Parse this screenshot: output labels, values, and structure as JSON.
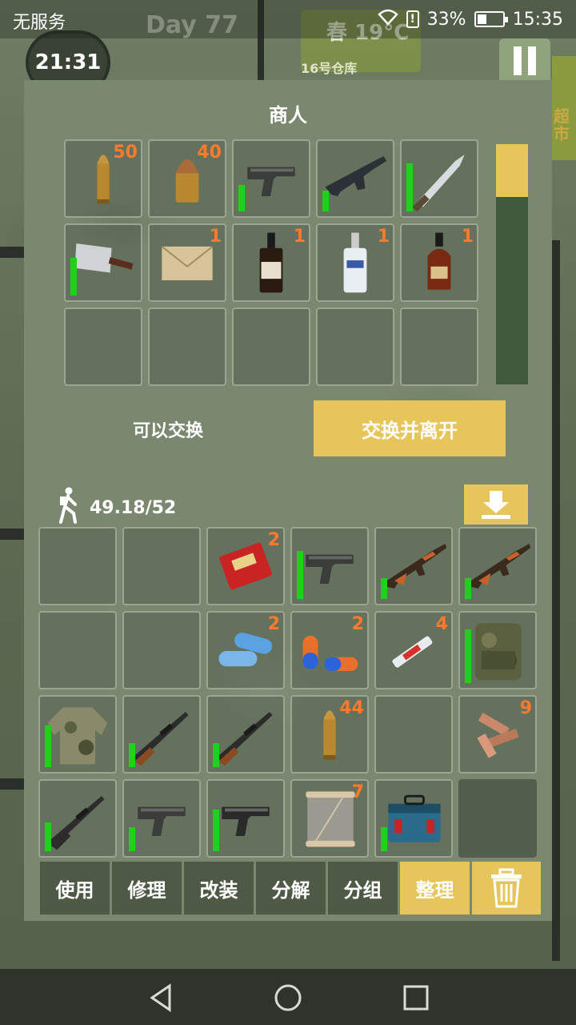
{
  "status_bar": {
    "carrier": "无服务",
    "battery_percent": "33%",
    "time": "15:35"
  },
  "hud": {
    "clock": "21:31",
    "day": "Day 77",
    "season": "春",
    "temperature": "19°C",
    "location": "16号仓库",
    "side_label": "超市"
  },
  "merchant": {
    "title": "商人",
    "items": [
      {
        "name": "rifle-ammo",
        "qty": "50",
        "durability": null
      },
      {
        "name": "pistol-ammo",
        "qty": "40",
        "durability": null
      },
      {
        "name": "pistol",
        "qty": null,
        "durability": 0.38
      },
      {
        "name": "assault-rifle",
        "qty": null,
        "durability": 0.3
      },
      {
        "name": "combat-knife",
        "qty": null,
        "durability": 0.7
      },
      {
        "name": "cleaver",
        "qty": null,
        "durability": 0.55
      },
      {
        "name": "envelope",
        "qty": "1",
        "durability": null
      },
      {
        "name": "whiskey",
        "qty": "1",
        "durability": null
      },
      {
        "name": "vodka",
        "qty": "1",
        "durability": null
      },
      {
        "name": "cognac",
        "qty": "1",
        "durability": null
      },
      {
        "name": "empty",
        "qty": null,
        "durability": null
      },
      {
        "name": "empty",
        "qty": null,
        "durability": null
      },
      {
        "name": "empty",
        "qty": null,
        "durability": null
      },
      {
        "name": "empty",
        "qty": null,
        "durability": null
      },
      {
        "name": "empty",
        "qty": null,
        "durability": null
      }
    ],
    "scroll_position": 0.0
  },
  "trade": {
    "status": "可以交换",
    "button": "交换并离开"
  },
  "inventory": {
    "weight": "49.18/52",
    "items": [
      {
        "name": "empty",
        "qty": null,
        "durability": null
      },
      {
        "name": "empty",
        "qty": null,
        "durability": null
      },
      {
        "name": "cigarettes",
        "qty": "2",
        "durability": null
      },
      {
        "name": "pistol",
        "qty": null,
        "durability": 0.7
      },
      {
        "name": "ak-rifle",
        "qty": null,
        "durability": 0.3
      },
      {
        "name": "ak-rifle",
        "qty": null,
        "durability": 0.3
      },
      {
        "name": "empty",
        "qty": null,
        "durability": null
      },
      {
        "name": "empty",
        "qty": null,
        "durability": null
      },
      {
        "name": "pills-blue",
        "qty": "2",
        "durability": null
      },
      {
        "name": "pills-orange",
        "qty": "2",
        "durability": null
      },
      {
        "name": "syringe",
        "qty": "4",
        "durability": null
      },
      {
        "name": "camo-backpack",
        "qty": null,
        "durability": 0.78
      },
      {
        "name": "camo-jacket",
        "qty": null,
        "durability": 0.6
      },
      {
        "name": "hunting-rifle",
        "qty": null,
        "durability": 0.35
      },
      {
        "name": "hunting-rifle",
        "qty": null,
        "durability": 0.35
      },
      {
        "name": "rifle-ammo",
        "qty": "44",
        "durability": null
      },
      {
        "name": "empty",
        "qty": null,
        "durability": null
      },
      {
        "name": "scrap-wood",
        "qty": "9",
        "durability": null
      },
      {
        "name": "sniper-rifle",
        "qty": null,
        "durability": 0.42
      },
      {
        "name": "pistol",
        "qty": null,
        "durability": 0.35
      },
      {
        "name": "pistol-black",
        "qty": null,
        "durability": 0.6
      },
      {
        "name": "thread-spool",
        "qty": "7",
        "durability": null
      },
      {
        "name": "toolbox",
        "qty": null,
        "durability": 0.35
      },
      {
        "name": "locked",
        "qty": null,
        "durability": null
      }
    ]
  },
  "actions": {
    "use": "使用",
    "repair": "修理",
    "modify": "改装",
    "disassemble": "分解",
    "group": "分组",
    "sort": "整理"
  },
  "colors": {
    "accent": "#e6c65a",
    "durability": "#1fd11b",
    "quantity": "#ff7a2c"
  }
}
